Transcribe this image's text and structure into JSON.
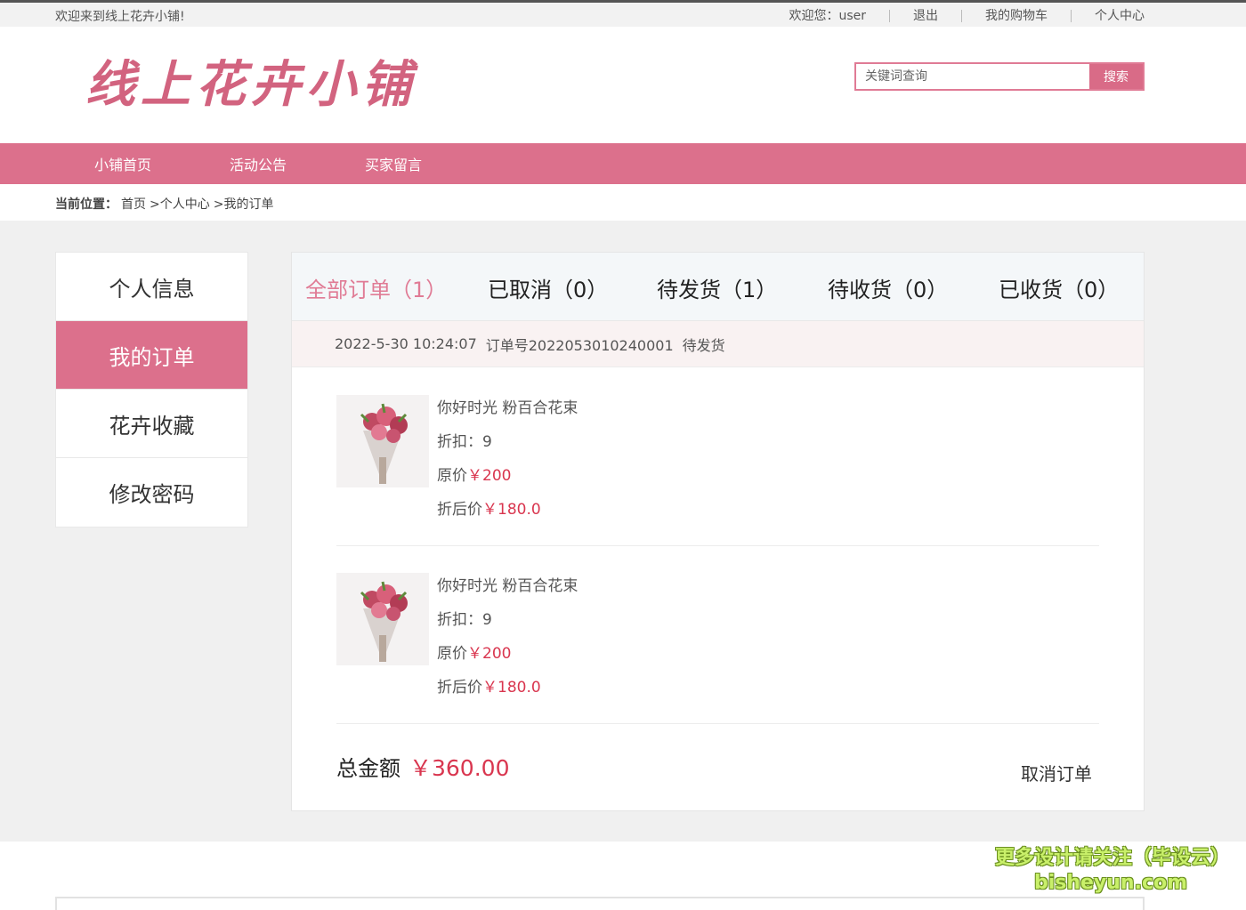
{
  "topbar": {
    "welcome": "欢迎来到线上花卉小铺!",
    "user_greeting": "欢迎您：user",
    "logout": "退出",
    "cart": "我的购物车",
    "profile": "个人中心"
  },
  "header": {
    "logo": "线上花卉小铺",
    "search_placeholder": "关键词查询",
    "search_button": "搜索"
  },
  "nav": {
    "items": [
      "小铺首页",
      "活动公告",
      "买家留言"
    ]
  },
  "breadcrumb": {
    "label": "当前位置：",
    "home": "首页",
    "sep1": ">个人中心",
    "sep2": ">我的订单"
  },
  "sidebar": {
    "items": [
      "个人信息",
      "我的订单",
      "花卉收藏",
      "修改密码"
    ],
    "active_index": 1
  },
  "tabs": [
    "全部订单（1）",
    "已取消（0）",
    "待发货（1）",
    "待收货（0）",
    "已收货（0）"
  ],
  "order": {
    "time": "2022-5-30 10:24:07",
    "number": "订单号2022053010240001",
    "status": "待发货",
    "items": [
      {
        "name": "你好时光 粉百合花束",
        "discount_label": "折扣：",
        "discount": "9",
        "orig_label": "原价",
        "orig_price": "￥200",
        "after_label": "折后价",
        "after_price": "￥180.0"
      },
      {
        "name": "你好时光 粉百合花束",
        "discount_label": "折扣：",
        "discount": "9",
        "orig_label": "原价",
        "orig_price": "￥200",
        "after_label": "折后价",
        "after_price": "￥180.0"
      }
    ],
    "total_label": "总金额",
    "total": "￥360.00",
    "cancel": "取消订单"
  },
  "watermark": {
    "line1": "更多设计请关注（毕设云）",
    "line2": "bisheyun.com"
  },
  "colors": {
    "accent": "#dc708c",
    "price": "#d9364f"
  }
}
